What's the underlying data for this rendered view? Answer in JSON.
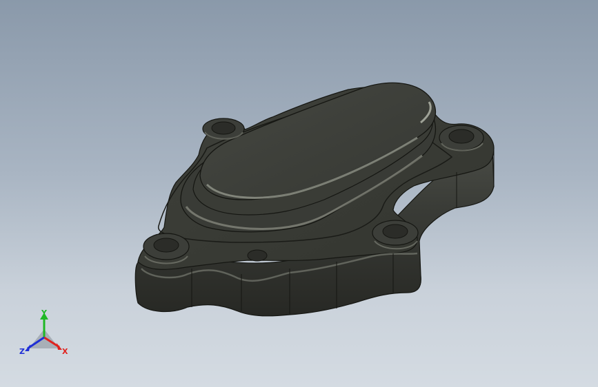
{
  "viewport": {
    "model": "cover-plate-part",
    "display_mode": "shaded-with-edges",
    "colors": {
      "background_top": "#8a99aa",
      "background_bottom": "#d4dbe2",
      "body": "#3b3d38",
      "body_light": "#5c5f57",
      "edge": "#151612"
    }
  },
  "triad": {
    "x_label": "X",
    "y_label": "Y",
    "z_label": "Z",
    "x_color": "#e0221e",
    "y_color": "#1fb825",
    "z_color": "#1f2fd6"
  }
}
